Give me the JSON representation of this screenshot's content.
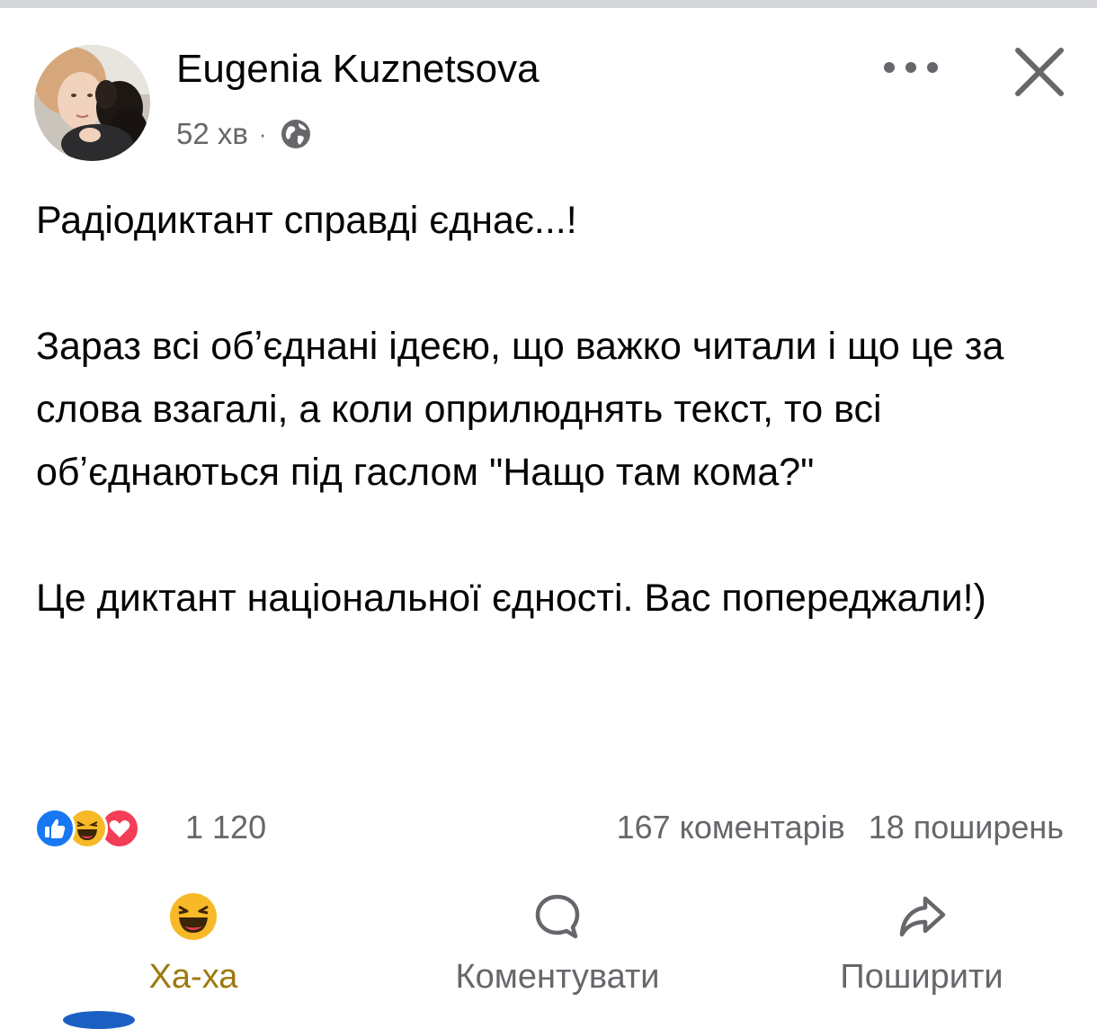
{
  "post": {
    "author": "Eugenia Kuznetsova",
    "time": "52 хв",
    "separator": "·",
    "privacy_icon": "globe-icon",
    "paragraphs": [
      "Радіодиктант справді єднає...!",
      "Зараз всі обʼєднані ідеєю, що важко читали і що це за слова взагалі, а коли оприлюднять текст, то всі обʼєднаються під гаслом \"Нащо там кома?\"",
      "Це диктант національної єдності. Вас попереджали!)"
    ]
  },
  "stats": {
    "reactions_count": "1 120",
    "reaction_icons": [
      "like-icon",
      "haha-icon",
      "love-icon"
    ],
    "comments": "167 коментарів",
    "shares": "18 поширень"
  },
  "actions": {
    "haha_label": "Ха-ха",
    "comment_label": "Коментувати",
    "share_label": "Поширити"
  },
  "colors": {
    "text": "#050505",
    "secondary": "#65676b",
    "like_blue": "#1877f2",
    "haha_yellow": "#f7b928",
    "love_red": "#f33e58",
    "haha_active": "#9d7a0e"
  }
}
